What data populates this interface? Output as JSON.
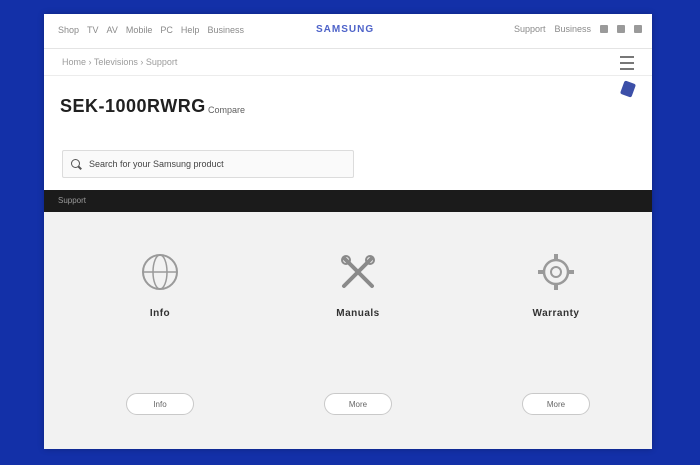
{
  "topbar": {
    "left_items": [
      "Shop",
      "TV",
      "AV",
      "Mobile",
      "PC",
      "Help",
      "Business"
    ],
    "brand": "SAMSUNG",
    "right_items": [
      "Support",
      "Business"
    ]
  },
  "breadcrumb": "Home › Televisions › Support",
  "product": {
    "title": "SEK-1000RWRG",
    "model_line": "",
    "link_text": "Compare"
  },
  "search": {
    "value": "Search for your Samsung product"
  },
  "band": {
    "label": "Support"
  },
  "cards": [
    {
      "icon": "globe-icon",
      "title": "Info",
      "desc": "",
      "button": "Info"
    },
    {
      "icon": "tools-icon",
      "title": "Manuals",
      "desc": "",
      "button": "More"
    },
    {
      "icon": "gear-icon",
      "title": "Warranty",
      "desc": "",
      "button": "More"
    }
  ],
  "colors": {
    "background": "#1330a8",
    "brand": "#4e63c9",
    "band": "#1b1b1b"
  }
}
